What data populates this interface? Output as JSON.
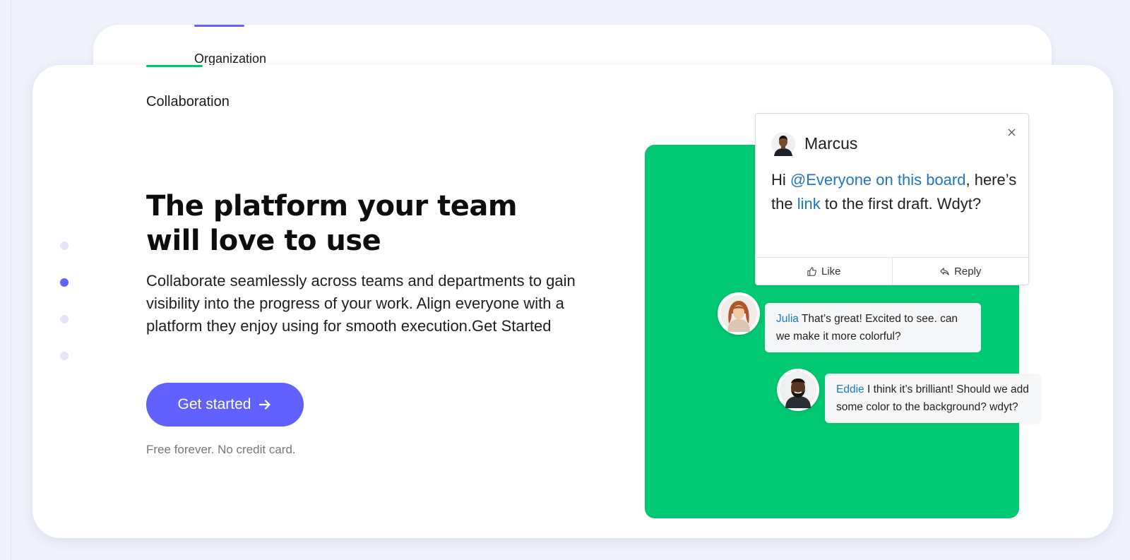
{
  "tabs": {
    "organization": "Organization",
    "collaboration": "Collaboration"
  },
  "slider": {
    "active_index": 2,
    "count": 4
  },
  "hero": {
    "headline_line1": "The platform your team",
    "headline_line2": "will love to use",
    "description": "Collaborate seamlessly across teams and departments to gain visibility into the progress of your work. Align everyone with a platform they enjoy using for smooth execution.Get Started",
    "cta_label": "Get started",
    "note": "Free forever. No credit card."
  },
  "comment": {
    "author": "Marcus",
    "text_hi": "Hi ",
    "mention_everyone": "@Everyone on this board",
    "text_middle": ", here’s the ",
    "mention_link": "link",
    "text_end": " to the first draft. Wdyt?",
    "like_label": "Like",
    "reply_label": "Reply"
  },
  "replies": [
    {
      "name": "Julia",
      "text": " That’s great! Excited to see. can we make it more colorful?"
    },
    {
      "name": "Eddie",
      "text": " I think it’s brilliant! Should we add some color to the background? wdyt?"
    }
  ],
  "colors": {
    "accent": "#6161ff",
    "green": "#00c972",
    "mention": "#1f76c2"
  },
  "icons": [
    "arrow-right-icon",
    "close-icon",
    "thumbs-up-icon",
    "reply-icon"
  ]
}
